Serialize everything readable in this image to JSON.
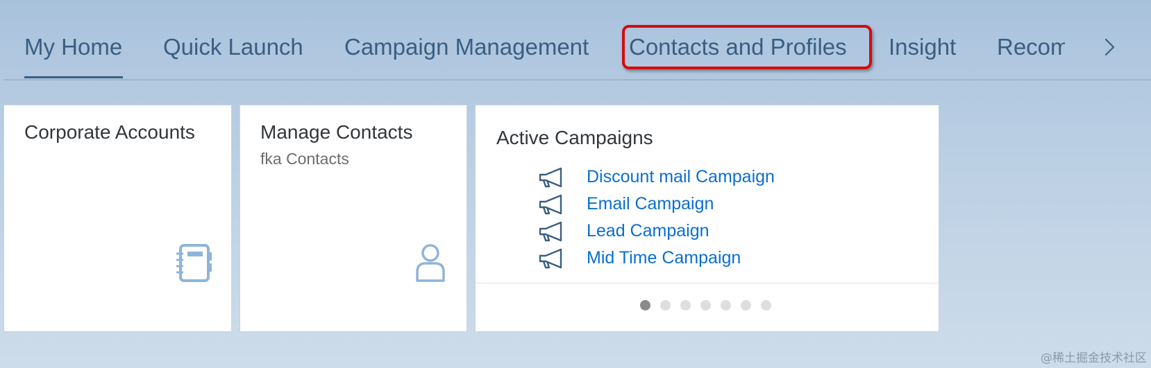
{
  "tabs": [
    {
      "label": "My Home",
      "selected": true
    },
    {
      "label": "Quick Launch",
      "selected": false
    },
    {
      "label": "Campaign Management",
      "selected": false
    },
    {
      "label": "Contacts and Profiles",
      "selected": false,
      "highlighted": true
    },
    {
      "label": "Insight",
      "selected": false
    },
    {
      "label": "Recom",
      "selected": false
    }
  ],
  "tab_overflow_icon": "chevron-right-icon",
  "tiles": {
    "corporate_accounts": {
      "title": "Corporate Accounts",
      "icon": "address-book-icon"
    },
    "manage_contacts": {
      "title": "Manage Contacts",
      "subtitle": "fka Contacts",
      "icon": "person-icon"
    },
    "active_campaigns": {
      "title": "Active Campaigns",
      "item_icon": "megaphone-icon",
      "items": [
        {
          "label": "Discount mail Campaign"
        },
        {
          "label": "Email Campaign"
        },
        {
          "label": "Lead Campaign"
        },
        {
          "label": "Mid Time Campaign"
        }
      ],
      "page_count": 7,
      "current_page": 1
    }
  },
  "colors": {
    "tab_text": "#3a5e81",
    "highlight": "#d50c0c",
    "link": "#0a6ed1",
    "icon": "#8fb4d8"
  },
  "watermark": "@稀土掘金技术社区"
}
